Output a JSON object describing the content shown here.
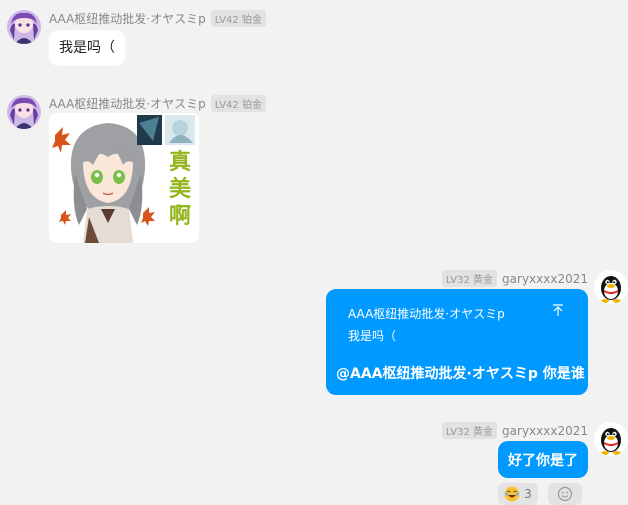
{
  "messages": [
    {
      "sender": "AAA枢纽推动批发·オヤスミp",
      "level": "LV42 铂金",
      "text": "我是吗（"
    },
    {
      "sender": "AAA枢纽推动批发·オヤスミp",
      "level": "LV42 铂金",
      "sticker_text": "真美啊"
    },
    {
      "sender": "garyxxxx2021",
      "level": "LV32 黄金",
      "quote_sender": "AAA枢纽推动批发·オヤスミp",
      "quote_text": "我是吗（",
      "text": "@AAA枢纽推动批发·オヤスミp 你是谁"
    },
    {
      "sender": "garyxxxx2021",
      "level": "LV32 黄金",
      "text": "好了你是了",
      "reaction_count": "3"
    }
  ],
  "colors": {
    "background": "#f2f2f2",
    "bubble_self": "#0099ff",
    "bubble_other": "#ffffff"
  }
}
